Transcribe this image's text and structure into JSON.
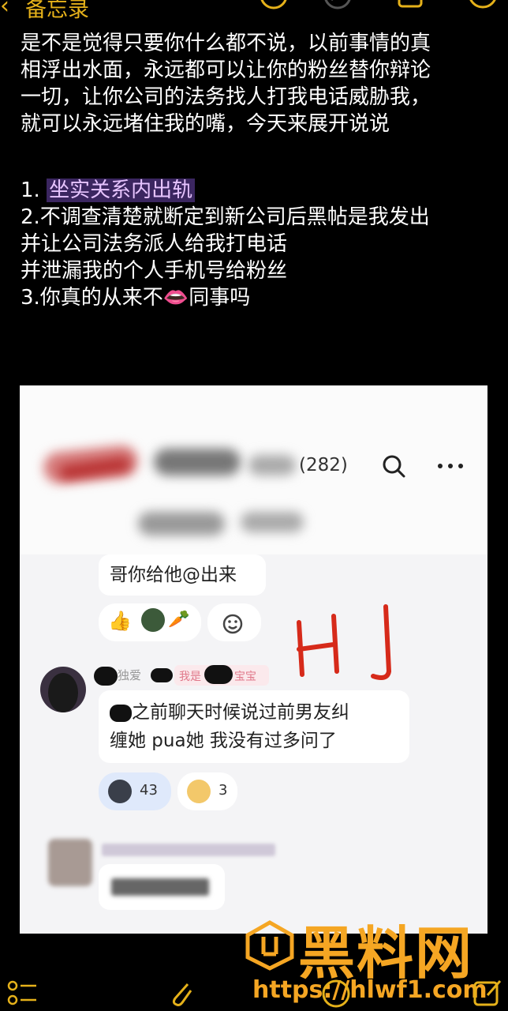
{
  "app": {
    "back_label": "备忘录"
  },
  "note": {
    "lines": [
      "是不是觉得只要你什么都不说，以前事情的真",
      "相浮出水面，永远都可以让你的粉丝替你辩论",
      "一切，让你公司的法务找人打我电话威胁我，",
      "就可以永远堵住我的嘴，今天来展开说说"
    ],
    "item1_prefix": "1. ",
    "item1_highlight": "坐实关系内出轨",
    "item2_line1": "2.不调查清楚就断定到新公司后黑帖是我发出",
    "item2_line2": "并让公司法务派人给我打电话",
    "item2_line3": "并泄漏我的个人手机号给粉丝",
    "item3_prefix": "3.你真的从来不",
    "item3_emoji": "👄",
    "item3_suffix": "同事吗"
  },
  "screenshot": {
    "member_count": "(282)",
    "msg1_text": "哥你给他@出来",
    "sender_fragment": "独爱",
    "badge_prefix": "我是",
    "badge_suffix": "宝宝",
    "msg2_text_line1": "之前聊天时候说过前男友纠",
    "msg2_text_line2": "缠她 pua她 我没有过多问了",
    "reaction1_count": "43",
    "reaction2_count": "3",
    "annotation": "HJ"
  },
  "watermark": {
    "brand": "黑料网",
    "url": "https://hlwf1.com"
  },
  "colors": {
    "accent": "#e5b11a",
    "highlight_bg": "#3b2660",
    "annotation": "#d62a1a"
  },
  "icons": [
    "chevron-left-icon",
    "undo-icon",
    "redo-icon",
    "share-icon",
    "more-icon",
    "search-icon",
    "checklist-icon",
    "attachment-icon",
    "compose-icon"
  ]
}
